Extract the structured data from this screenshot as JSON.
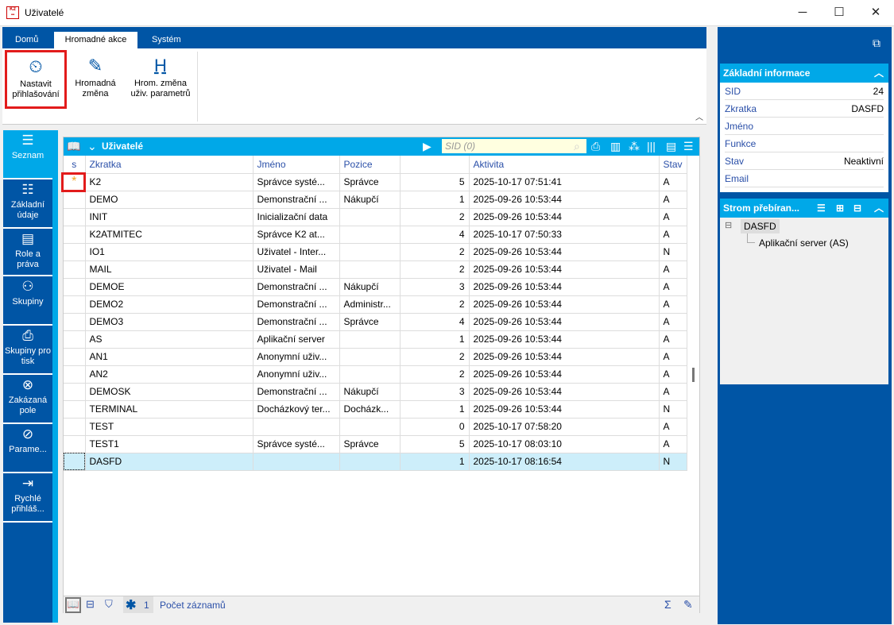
{
  "window": {
    "title": "Uživatelé",
    "logo_text": "K2"
  },
  "tabs": [
    {
      "label": "Domů"
    },
    {
      "label": "Hromadné akce"
    },
    {
      "label": "Systém"
    }
  ],
  "ribbon": [
    {
      "label1": "Nastavit",
      "label2": "přihlašování",
      "icon": "login-schedule-icon"
    },
    {
      "label1": "Hromadná",
      "label2": "změna",
      "icon": "pencil-icon"
    },
    {
      "label1": "Hrom. změna",
      "label2": "uživ. parametrů",
      "icon": "h-parameter-icon"
    }
  ],
  "nav": [
    {
      "label": "Seznam",
      "icon": "list-icon"
    },
    {
      "label": "Základní údaje",
      "icon": "details-icon"
    },
    {
      "label": "Role a práva",
      "icon": "roles-icon"
    },
    {
      "label": "Skupiny",
      "icon": "groups-icon"
    },
    {
      "label": "Skupiny pro tisk",
      "icon": "print-groups-icon"
    },
    {
      "label": "Zakázaná pole",
      "icon": "forbidden-fields-icon"
    },
    {
      "label": "Parame...",
      "icon": "parameters-icon"
    },
    {
      "label": "Rychlé přihláš...",
      "icon": "quick-login-icon"
    }
  ],
  "grid": {
    "title": "Uživatelé",
    "search_placeholder": "SID (0)",
    "columns": [
      "s",
      "Zkratka",
      "Jméno",
      "Pozice",
      "",
      "Aktivita",
      "Stav"
    ],
    "rows": [
      [
        "*",
        "K2",
        "Správce systé...",
        "Správce",
        "5",
        "2025-10-17 07:51:41",
        "A"
      ],
      [
        "",
        "DEMO",
        "Demonstrační ...",
        "Nákupčí",
        "1",
        "2025-09-26 10:53:44",
        "A"
      ],
      [
        "",
        "INIT",
        "Inicializační data",
        "",
        "2",
        "2025-09-26 10:53:44",
        "A"
      ],
      [
        "",
        "K2ATMITEC",
        "Správce K2 at...",
        "",
        "4",
        "2025-10-17 07:50:33",
        "A"
      ],
      [
        "",
        "IO1",
        "Uživatel - Inter...",
        "",
        "2",
        "2025-09-26 10:53:44",
        "N"
      ],
      [
        "",
        "MAIL",
        "Uživatel - Mail",
        "",
        "2",
        "2025-09-26 10:53:44",
        "A"
      ],
      [
        "",
        "DEMOE",
        "Demonstrační ...",
        "Nákupčí",
        "3",
        "2025-09-26 10:53:44",
        "A"
      ],
      [
        "",
        "DEMO2",
        "Demonstrační ...",
        "Administr...",
        "2",
        "2025-09-26 10:53:44",
        "A"
      ],
      [
        "",
        "DEMO3",
        "Demonstrační ...",
        "Správce",
        "4",
        "2025-09-26 10:53:44",
        "A"
      ],
      [
        "",
        "AS",
        "Aplikační server",
        "",
        "1",
        "2025-09-26 10:53:44",
        "A"
      ],
      [
        "",
        "AN1",
        "Anonymní uživ...",
        "",
        "2",
        "2025-09-26 10:53:44",
        "A"
      ],
      [
        "",
        "AN2",
        "Anonymní uživ...",
        "",
        "2",
        "2025-09-26 10:53:44",
        "A"
      ],
      [
        "",
        "DEMOSK",
        "Demonstrační ...",
        "Nákupčí",
        "3",
        "2025-09-26 10:53:44",
        "A"
      ],
      [
        "",
        "TERMINAL",
        "Docházkový ter...",
        "Docházk...",
        "1",
        "2025-09-26 10:53:44",
        "N"
      ],
      [
        "",
        "TEST",
        "",
        "",
        "0",
        "2025-10-17 07:58:20",
        "A"
      ],
      [
        "",
        "TEST1",
        "Správce systé...",
        "Správce",
        "5",
        "2025-10-17 08:03:10",
        "A"
      ],
      [
        "",
        "DASFD",
        "",
        "",
        "1",
        "2025-10-17 08:16:54",
        "N"
      ]
    ],
    "selected_row": 16,
    "footer": {
      "marked_count": "1",
      "record_count_label": "Počet záznamů"
    }
  },
  "info": {
    "title": "Základní informace",
    "rows": [
      {
        "label": "SID",
        "value": "24"
      },
      {
        "label": "Zkratka",
        "value": "DASFD"
      },
      {
        "label": "Jméno",
        "value": ""
      },
      {
        "label": "Funkce",
        "value": ""
      },
      {
        "label": "Stav",
        "value": "Neaktivní"
      },
      {
        "label": "Email",
        "value": ""
      }
    ]
  },
  "tree": {
    "title": "Strom přebíran...",
    "root": "DASFD",
    "child": "Aplikační server (AS)"
  },
  "colors": {
    "dark_blue": "#0055a5",
    "cyan": "#00a8e8",
    "highlight": "#e21b1b",
    "star": "#f5a623"
  }
}
